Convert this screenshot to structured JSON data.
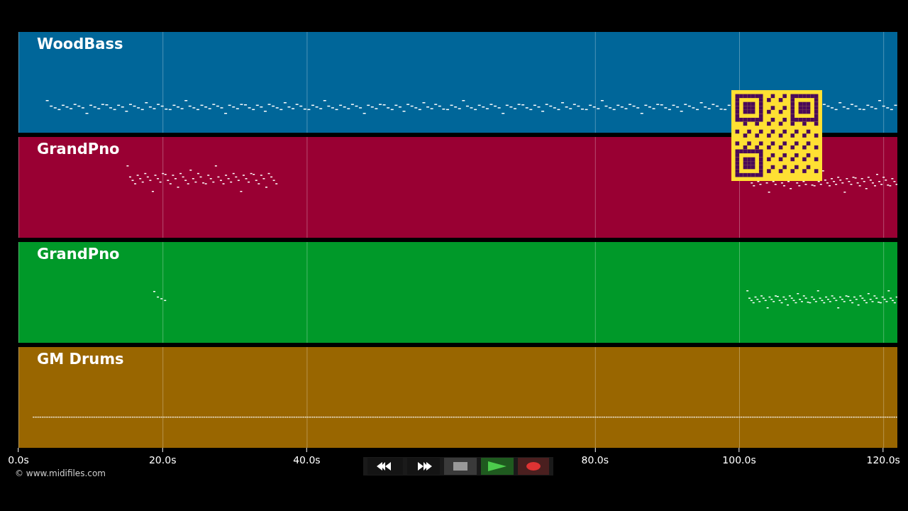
{
  "tracks": [
    {
      "name": "WoodBass",
      "color": "#006699"
    },
    {
      "name": "GrandPno",
      "color": "#990033"
    },
    {
      "name": "GrandPno",
      "color": "#009929"
    },
    {
      "name": "GM Drums",
      "color": "#996600"
    }
  ],
  "time_axis": [
    "0.0s",
    "20.0s",
    "40.0s",
    "80.0s",
    "100.0s",
    "120.0s"
  ],
  "credit": "© www.midifiles.com",
  "transport": [
    {
      "kind": "rewind"
    },
    {
      "kind": "forward"
    },
    {
      "kind": "stop"
    },
    {
      "kind": "play"
    },
    {
      "kind": "record"
    }
  ]
}
